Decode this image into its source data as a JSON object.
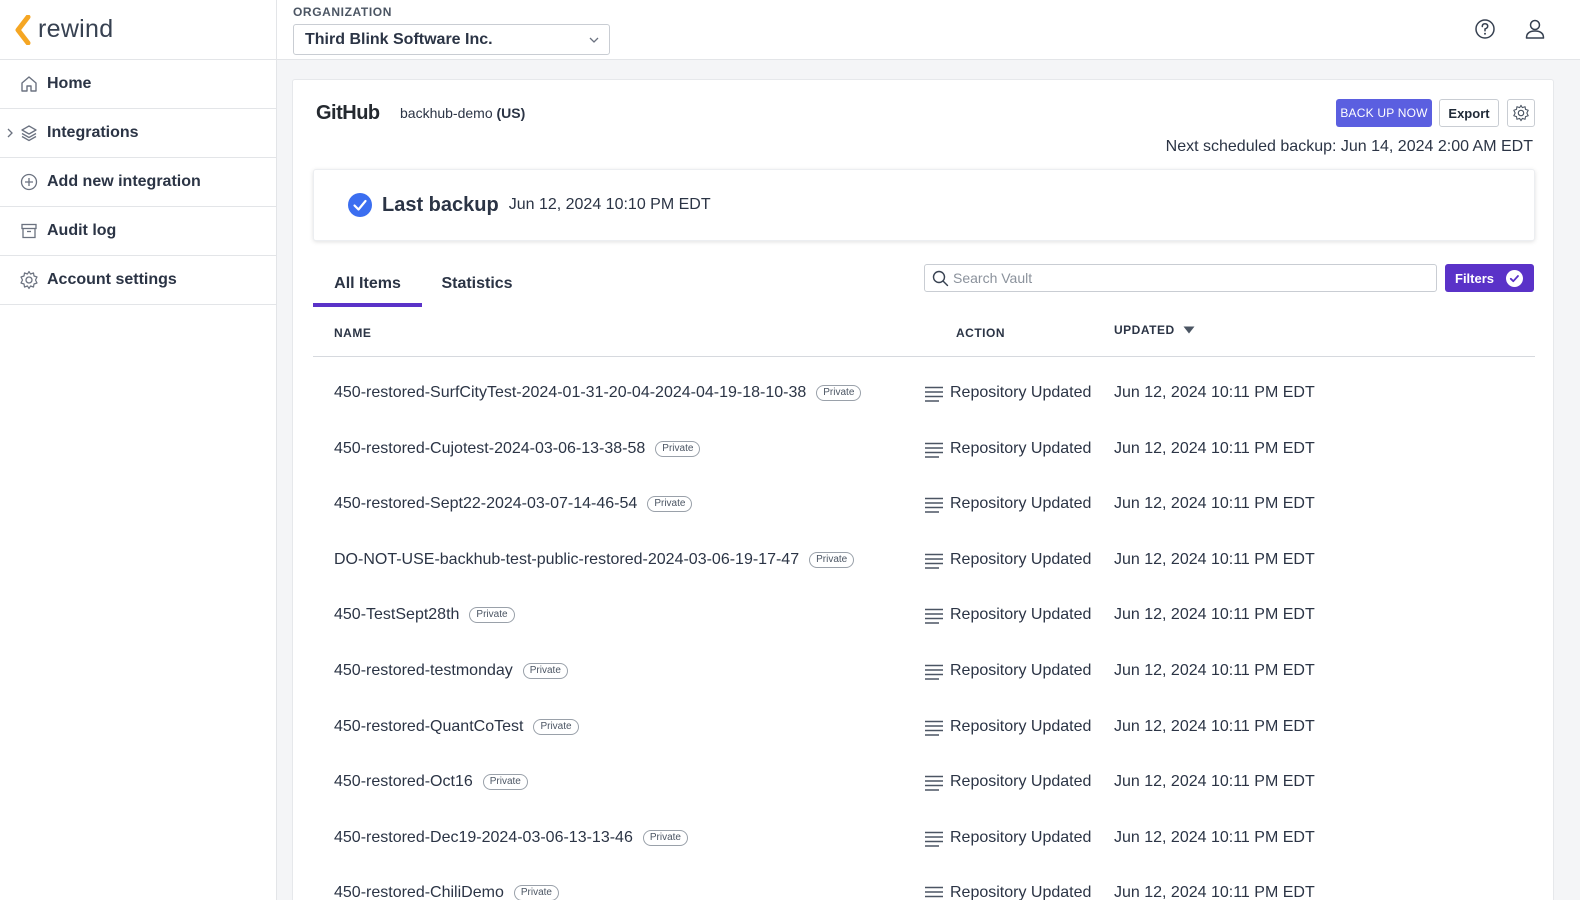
{
  "app": {
    "logo_text": "rewind",
    "brand_color": "#f5a623",
    "accent_color": "#5a32c8"
  },
  "sidebar": {
    "items": [
      {
        "label": "Home",
        "icon": "home-icon"
      },
      {
        "label": "Integrations",
        "icon": "layers-icon",
        "expandable": true
      },
      {
        "label": "Add new integration",
        "icon": "plus-circle-icon"
      },
      {
        "label": "Audit log",
        "icon": "archive-icon"
      },
      {
        "label": "Account settings",
        "icon": "gear-icon"
      }
    ]
  },
  "header": {
    "org_label": "ORGANIZATION",
    "org_value": "Third Blink Software Inc.",
    "icons": [
      "help-icon",
      "user-icon"
    ]
  },
  "integration": {
    "platform": "GitHub",
    "account": "backhub-demo",
    "region": "(US)",
    "backup_now_label": "BACK UP NOW",
    "export_label": "Export",
    "next_backup": "Next scheduled backup: Jun 14, 2024 2:00 AM EDT"
  },
  "last_backup": {
    "title": "Last backup",
    "date": "Jun 12, 2024 10:10 PM EDT",
    "status": "success"
  },
  "tabs": [
    {
      "label": "All Items",
      "active": true
    },
    {
      "label": "Statistics",
      "active": false
    }
  ],
  "search": {
    "placeholder": "Search Vault",
    "value": ""
  },
  "filters_label": "Filters",
  "table": {
    "columns": {
      "name": "NAME",
      "action": "ACTION",
      "updated": "UPDATED"
    },
    "sort": {
      "column": "updated",
      "direction": "desc"
    },
    "rows": [
      {
        "name": "450-restored-SurfCityTest-2024-01-31-20-04-2024-04-19-18-10-38",
        "badge": "Private",
        "action": "Repository Updated",
        "updated": "Jun 12, 2024 10:11 PM EDT"
      },
      {
        "name": "450-restored-Cujotest-2024-03-06-13-38-58",
        "badge": "Private",
        "action": "Repository Updated",
        "updated": "Jun 12, 2024 10:11 PM EDT"
      },
      {
        "name": "450-restored-Sept22-2024-03-07-14-46-54",
        "badge": "Private",
        "action": "Repository Updated",
        "updated": "Jun 12, 2024 10:11 PM EDT"
      },
      {
        "name": "DO-NOT-USE-backhub-test-public-restored-2024-03-06-19-17-47",
        "badge": "Private",
        "action": "Repository Updated",
        "updated": "Jun 12, 2024 10:11 PM EDT"
      },
      {
        "name": "450-TestSept28th",
        "badge": "Private",
        "action": "Repository Updated",
        "updated": "Jun 12, 2024 10:11 PM EDT"
      },
      {
        "name": "450-restored-testmonday",
        "badge": "Private",
        "action": "Repository Updated",
        "updated": "Jun 12, 2024 10:11 PM EDT"
      },
      {
        "name": "450-restored-QuantCoTest",
        "badge": "Private",
        "action": "Repository Updated",
        "updated": "Jun 12, 2024 10:11 PM EDT"
      },
      {
        "name": "450-restored-Oct16",
        "badge": "Private",
        "action": "Repository Updated",
        "updated": "Jun 12, 2024 10:11 PM EDT"
      },
      {
        "name": "450-restored-Dec19-2024-03-06-13-13-46",
        "badge": "Private",
        "action": "Repository Updated",
        "updated": "Jun 12, 2024 10:11 PM EDT"
      },
      {
        "name": "450-restored-ChiliDemo",
        "badge": "Private",
        "action": "Repository Updated",
        "updated": "Jun 12, 2024 10:11 PM EDT"
      }
    ]
  }
}
